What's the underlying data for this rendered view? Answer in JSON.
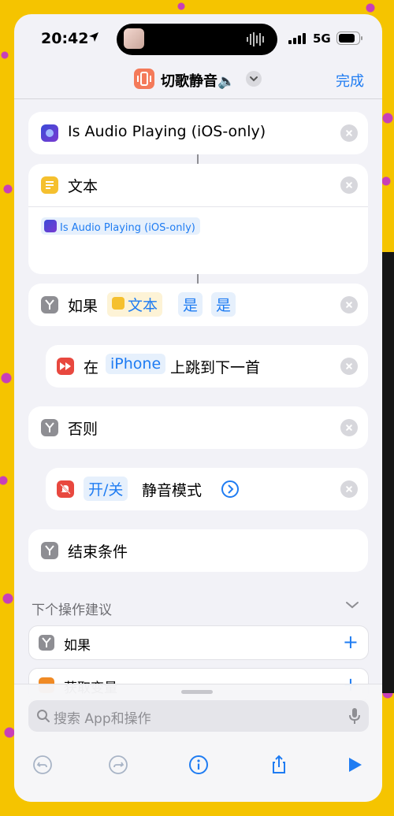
{
  "status_bar": {
    "time": "20:42",
    "network": "5G"
  },
  "nav": {
    "title": "切歌静音🔈",
    "done_label": "完成"
  },
  "actions": [
    {
      "label": "Is Audio Playing (iOS-only)"
    },
    {
      "label": "文本",
      "variable_chip": "Is Audio Playing (iOS-only)"
    },
    {
      "label_prefix": "如果",
      "token_var": "文本",
      "token_cond": "是",
      "token_value": "是"
    },
    {
      "label_prefix": "在",
      "token_device": "iPhone",
      "label_suffix": "上跳到下一首"
    },
    {
      "label": "否则"
    },
    {
      "token_toggle": "开/关",
      "label_suffix": "静音模式"
    },
    {
      "label": "结束条件"
    }
  ],
  "suggestions": {
    "title": "下个操作建议",
    "items": [
      {
        "label": "如果"
      },
      {
        "label": "获取变量"
      }
    ]
  },
  "search": {
    "placeholder": "搜索 App和操作"
  },
  "colors": {
    "accent": "#1f7cf2",
    "app_orange": "#f47a5a",
    "text_icon_yellow": "#f5c02e",
    "condition_gray": "#8e8e93",
    "media_red": "#e8483f",
    "background_yellow": "#f5c400",
    "polka_magenta": "#c83fb8"
  },
  "icons": [
    "location-arrow-icon",
    "waveform-icon",
    "signal-bars-icon",
    "battery-icon",
    "chevron-down-icon",
    "siri-shortcut-icon",
    "text-icon",
    "branch-icon",
    "fast-forward-icon",
    "silent-bell-icon",
    "chevron-right-circle-icon",
    "close-icon",
    "plus-icon",
    "search-icon",
    "microphone-icon",
    "undo-icon",
    "redo-icon",
    "info-icon",
    "share-icon",
    "play-icon"
  ]
}
